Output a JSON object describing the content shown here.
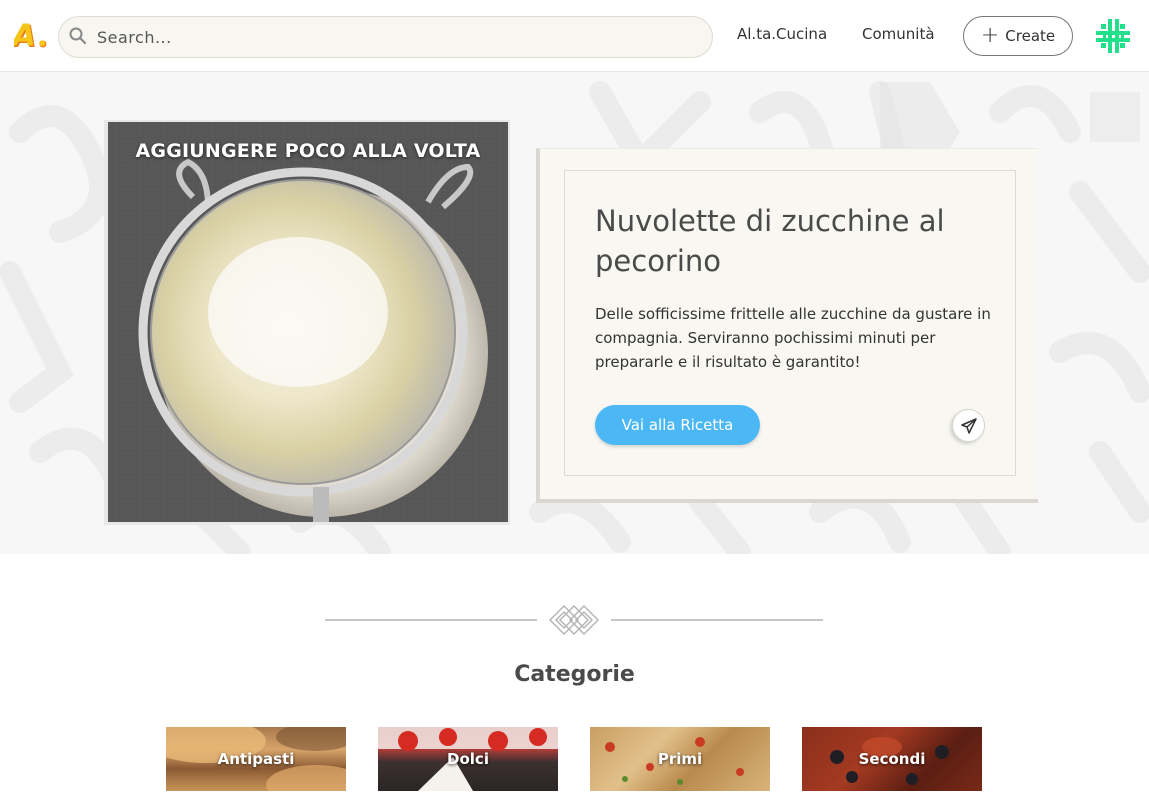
{
  "header": {
    "logo_text": "A.",
    "search_placeholder": "Search...",
    "nav": [
      "Al.ta.Cucina",
      "Comunità"
    ],
    "create_label": "Create",
    "accent_color": "#4bb8f5",
    "logo_color": "#f5c518"
  },
  "hero": {
    "image_caption": "AGGIUNGERE POCO ALLA VOLTA",
    "title": "Nuvolette di zucchine al pecorino",
    "description": "Delle sofficissime frittelle alle zucchine da gustare in compagnia. Serviranno pochissimi minuti per prepararle e il risultato è garantito!",
    "cta_label": "Vai alla Ricetta",
    "share_icon": "paper-plane-icon"
  },
  "categories": {
    "title": "Categorie",
    "items": [
      {
        "label": "Antipasti"
      },
      {
        "label": "Dolci"
      },
      {
        "label": "Primi"
      },
      {
        "label": "Secondi"
      }
    ]
  }
}
